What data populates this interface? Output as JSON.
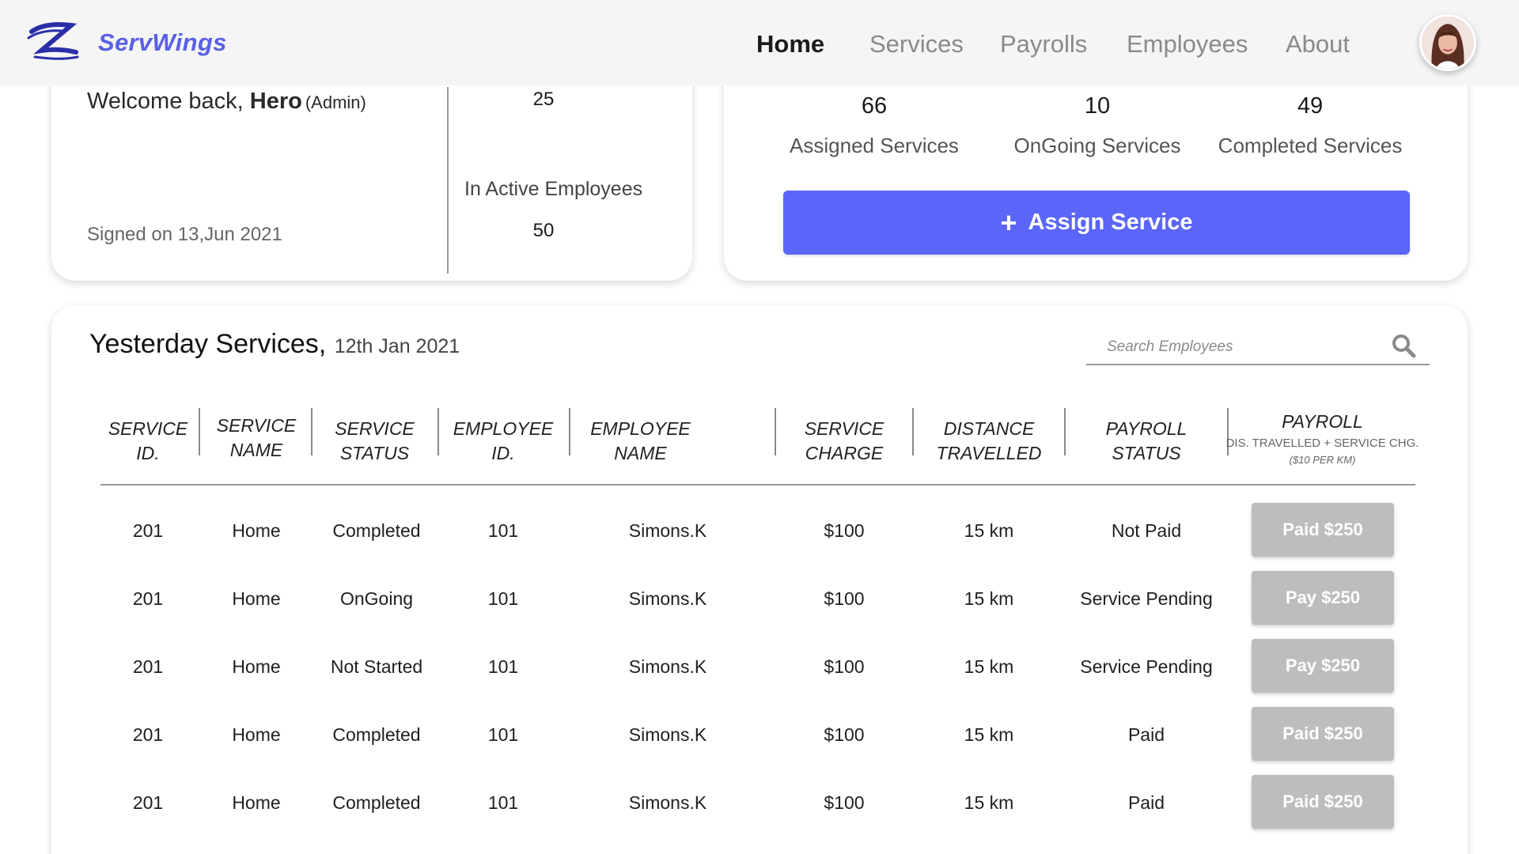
{
  "brand": {
    "name": "ServWings"
  },
  "nav": {
    "items": [
      {
        "label": "Home",
        "active": true
      },
      {
        "label": "Services",
        "active": false
      },
      {
        "label": "Payrolls",
        "active": false
      },
      {
        "label": "Employees",
        "active": false
      },
      {
        "label": "About",
        "active": false
      }
    ]
  },
  "welcome": {
    "greeting": "Welcome back, ",
    "name": "Hero",
    "role": "(Admin)",
    "signed": "Signed on 13,Jun 2021"
  },
  "employees": {
    "active_count": "25",
    "inactive_label": "In Active Employees",
    "inactive_count": "50"
  },
  "stats": [
    {
      "value": "66",
      "label": "Assigned Services"
    },
    {
      "value": "10",
      "label": "OnGoing Services"
    },
    {
      "value": "49",
      "label": "Completed Services"
    }
  ],
  "assign_button": {
    "icon": "+",
    "label": "Assign Service"
  },
  "table": {
    "title": "Yesterday Services,",
    "date": "12th Jan 2021",
    "search_placeholder": "Search Employees",
    "headers": [
      {
        "line1": "SERVICE",
        "line2": "ID."
      },
      {
        "line1": "SERVICE",
        "line2": "NAME"
      },
      {
        "line1": "SERVICE",
        "line2": "STATUS"
      },
      {
        "line1": "EMPLOYEE",
        "line2": "ID."
      },
      {
        "line1": "EMPLOYEE",
        "line2": "NAME"
      },
      {
        "line1": "SERVICE",
        "line2": "CHARGE"
      },
      {
        "line1": "DISTANCE",
        "line2": "TRAVELLED"
      },
      {
        "line1": "PAYROLL",
        "line2": "STATUS"
      }
    ],
    "payroll_header": {
      "title": "PAYROLL",
      "sub1": "DIS. TRAVELLED + SERVICE CHG.",
      "sub2": "($10 PER KM)"
    },
    "rows": [
      {
        "service_id": "201",
        "service_name": "Home",
        "service_status": "Completed",
        "employee_id": "101",
        "employee_name": "Simons.K",
        "service_charge": "$100",
        "distance": "15 km",
        "payroll_status": "Not Paid",
        "action": "Paid $250"
      },
      {
        "service_id": "201",
        "service_name": "Home",
        "service_status": "OnGoing",
        "employee_id": "101",
        "employee_name": "Simons.K",
        "service_charge": "$100",
        "distance": "15 km",
        "payroll_status": "Service Pending",
        "action": "Pay $250"
      },
      {
        "service_id": "201",
        "service_name": "Home",
        "service_status": "Not Started",
        "employee_id": "101",
        "employee_name": "Simons.K",
        "service_charge": "$100",
        "distance": "15 km",
        "payroll_status": "Service Pending",
        "action": "Pay $250"
      },
      {
        "service_id": "201",
        "service_name": "Home",
        "service_status": "Completed",
        "employee_id": "101",
        "employee_name": "Simons.K",
        "service_charge": "$100",
        "distance": "15 km",
        "payroll_status": "Paid",
        "action": "Paid $250"
      },
      {
        "service_id": "201",
        "service_name": "Home",
        "service_status": "Completed",
        "employee_id": "101",
        "employee_name": "Simons.K",
        "service_charge": "$100",
        "distance": "15 km",
        "payroll_status": "Paid",
        "action": "Paid $250"
      }
    ]
  },
  "colors": {
    "accent": "#5b66f8",
    "brand": "#5a5fe6",
    "button_disabled": "#bdbdbd"
  }
}
